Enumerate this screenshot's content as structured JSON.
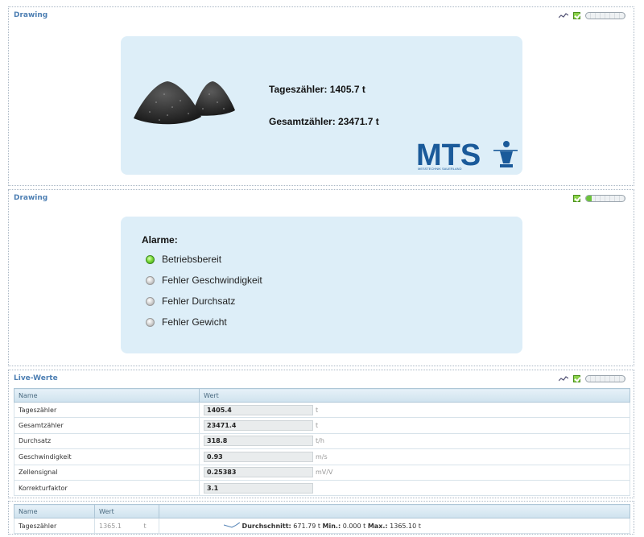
{
  "drawing1": {
    "title": "Drawing",
    "progress": 0,
    "counter_day": "Tageszähler: 1405.7 t",
    "counter_total": "Gesamtzähler: 23471.7 t",
    "logo_text": "MTS",
    "logo_sub": "MESSTECHNIK SAUERLAND"
  },
  "drawing2": {
    "title": "Drawing",
    "progress": 0.15,
    "alarm_heading": "Alarme:",
    "alarms": [
      {
        "label": "Betriebsbereit",
        "active": true
      },
      {
        "label": "Fehler Geschwindigkeit",
        "active": false
      },
      {
        "label": "Fehler Durchsatz",
        "active": false
      },
      {
        "label": "Fehler Gewicht",
        "active": false
      }
    ]
  },
  "live": {
    "title": "Live-Werte",
    "progress": 0,
    "col_name": "Name",
    "col_value": "Wert",
    "rows": [
      {
        "name": "Tageszähler",
        "value": "1405.4",
        "unit": "t"
      },
      {
        "name": "Gesamtzähler",
        "value": "23471.4",
        "unit": "t"
      },
      {
        "name": "Durchsatz",
        "value": "318.8",
        "unit": "t/h"
      },
      {
        "name": "Geschwindigkeit",
        "value": "0.93",
        "unit": "m/s"
      },
      {
        "name": "Zellensignal",
        "value": "0.25383",
        "unit": "mV/V"
      },
      {
        "name": "Korrekturfaktor",
        "value": "3.1",
        "unit": ""
      }
    ]
  },
  "stats": {
    "col_name": "Name",
    "col_value": "Wert",
    "row": {
      "name": "Tageszähler",
      "value": "1365.1",
      "unit": "t",
      "summary_label": "Durchschnitt:",
      "summary_avg": "671.79 t",
      "min_label": "Min.:",
      "min_value": "0.000 t",
      "max_label": "Max.:",
      "max_value": "1365.10 t"
    }
  },
  "colors": {
    "accent": "#4d7fb3",
    "card_bg": "#ddeef8",
    "logo_blue": "#1a5a9a",
    "led_on": "#6cc23b"
  }
}
